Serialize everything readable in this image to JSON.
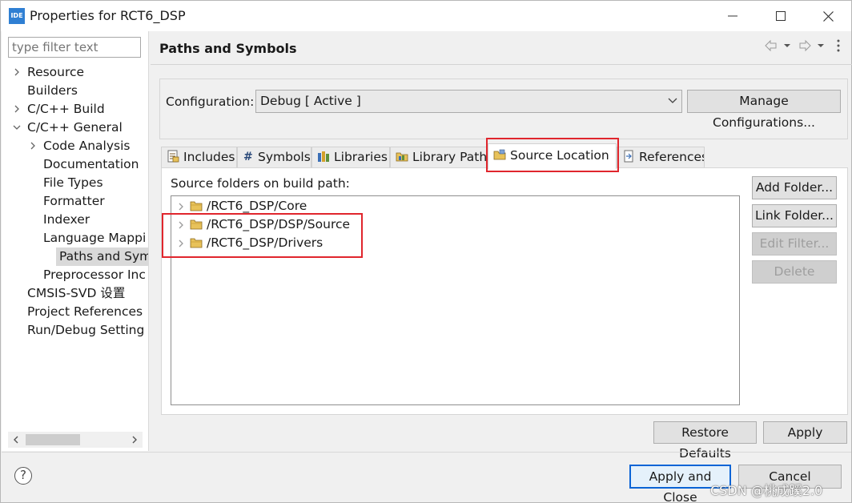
{
  "window": {
    "app_icon_text": "IDE",
    "title": "Properties for RCT6_DSP"
  },
  "left": {
    "filter_placeholder": "type filter text",
    "tree": [
      {
        "label": "Resource",
        "indent": 0,
        "twisty": "collapsed"
      },
      {
        "label": "Builders",
        "indent": 0,
        "twisty": "none"
      },
      {
        "label": "C/C++ Build",
        "indent": 0,
        "twisty": "collapsed"
      },
      {
        "label": "C/C++ General",
        "indent": 0,
        "twisty": "expanded"
      },
      {
        "label": "Code Analysis",
        "indent": 1,
        "twisty": "collapsed"
      },
      {
        "label": "Documentation",
        "indent": 1,
        "twisty": "none"
      },
      {
        "label": "File Types",
        "indent": 1,
        "twisty": "none"
      },
      {
        "label": "Formatter",
        "indent": 1,
        "twisty": "none"
      },
      {
        "label": "Indexer",
        "indent": 1,
        "twisty": "none"
      },
      {
        "label": "Language Mappi",
        "indent": 1,
        "twisty": "none"
      },
      {
        "label": "Paths and Symbo",
        "indent": 1,
        "twisty": "none",
        "selected": true
      },
      {
        "label": "Preprocessor Inc",
        "indent": 1,
        "twisty": "none"
      },
      {
        "label": "CMSIS-SVD 设置",
        "indent": 0,
        "twisty": "none"
      },
      {
        "label": "Project References",
        "indent": 0,
        "twisty": "none"
      },
      {
        "label": "Run/Debug Setting",
        "indent": 0,
        "twisty": "none"
      }
    ]
  },
  "main": {
    "heading": "Paths and Symbols",
    "configuration_label": "Configuration:",
    "configuration_value": "Debug  [ Active ]",
    "manage_button": "Manage Configurations...",
    "tabs": [
      {
        "label": "Includes",
        "icon": "includes-icon"
      },
      {
        "label": "Symbols",
        "icon": "hash-icon"
      },
      {
        "label": "Libraries",
        "icon": "libraries-icon"
      },
      {
        "label": "Library Paths",
        "icon": "library-paths-icon"
      },
      {
        "label": "Source Location",
        "icon": "source-folder-icon",
        "active": true
      },
      {
        "label": "References",
        "icon": "references-icon"
      }
    ],
    "source_folders_label": "Source folders on build path:",
    "source_folders": [
      "/RCT6_DSP/Core",
      "/RCT6_DSP/DSP/Source",
      "/RCT6_DSP/Drivers"
    ],
    "side_buttons": {
      "add_folder": "Add Folder...",
      "link_folder": "Link Folder...",
      "edit_filter": "Edit Filter...",
      "delete": "Delete"
    },
    "restore_defaults": "Restore Defaults",
    "apply": "Apply"
  },
  "footer": {
    "help": "?",
    "apply_and_close": "Apply and Close",
    "cancel": "Cancel"
  },
  "watermark": "CSDN @桃成蹊2.0",
  "colors": {
    "highlight_box": "#e0262d",
    "selection": "#d9d9d9",
    "primary_button_border": "#0a64d6"
  }
}
